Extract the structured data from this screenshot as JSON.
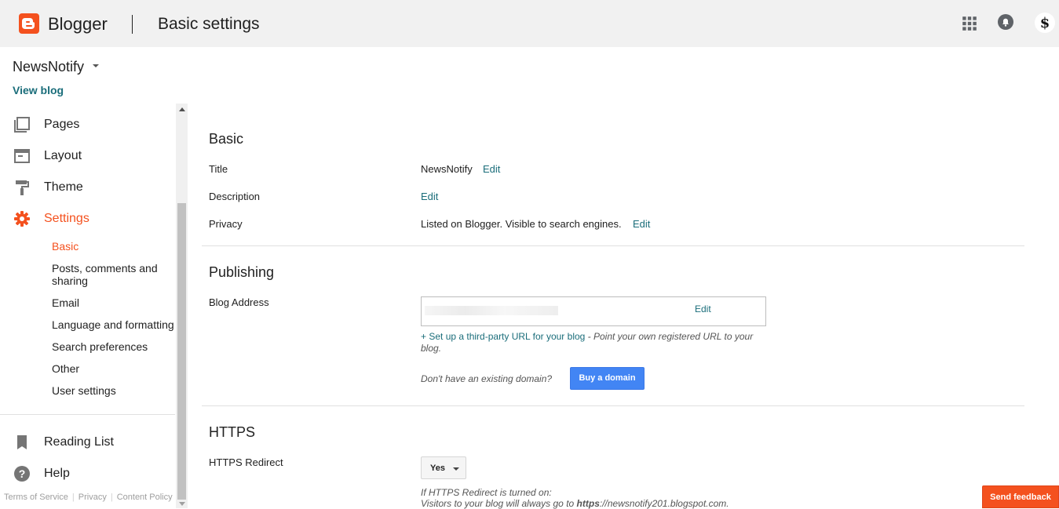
{
  "header": {
    "brand": "Blogger",
    "page_title": "Basic settings",
    "avatar_letter": "$",
    "accent": "#f4511e",
    "icons": [
      "apps-icon",
      "notifications-icon",
      "account-avatar"
    ]
  },
  "sidebar": {
    "blog_name": "NewsNotify",
    "view_blog": "View blog",
    "nav": [
      {
        "label": "Pages",
        "icon": "pages-icon"
      },
      {
        "label": "Layout",
        "icon": "layout-icon"
      },
      {
        "label": "Theme",
        "icon": "theme-roller-icon"
      },
      {
        "label": "Settings",
        "icon": "gear-icon"
      }
    ],
    "settings_sub": [
      "Basic",
      "Posts, comments and sharing",
      "Email",
      "Language and formatting",
      "Search preferences",
      "Other",
      "User settings"
    ],
    "bottom_nav": [
      {
        "label": "Reading List",
        "icon": "bookmark-icon"
      },
      {
        "label": "Help",
        "icon": "help-icon"
      }
    ],
    "footer_links": [
      "Terms of Service",
      "Privacy",
      "Content Policy"
    ]
  },
  "basic": {
    "title": "Basic",
    "rows": {
      "title_label": "Title",
      "title_value": "NewsNotify",
      "description_label": "Description",
      "privacy_label": "Privacy",
      "privacy_value": "Listed on Blogger. Visible to search engines."
    },
    "edit": "Edit"
  },
  "publishing": {
    "title": "Publishing",
    "blog_address_label": "Blog Address",
    "edit": "Edit",
    "third_party_link": "+ Set up a third-party URL for your blog",
    "third_party_desc": " - Point your own registered URL to your blog.",
    "no_domain": "Don't have an existing domain?",
    "buy_domain": "Buy a domain"
  },
  "https": {
    "title": "HTTPS",
    "redirect_label": "HTTPS Redirect",
    "redirect_value": "Yes",
    "note_line1": "If HTTPS Redirect is turned on:",
    "note_prefix": "Visitors to your blog will always go to ",
    "note_bold": "https",
    "note_suffix": "://newsnotify201.blogspot.com."
  },
  "feedback": "Send feedback"
}
